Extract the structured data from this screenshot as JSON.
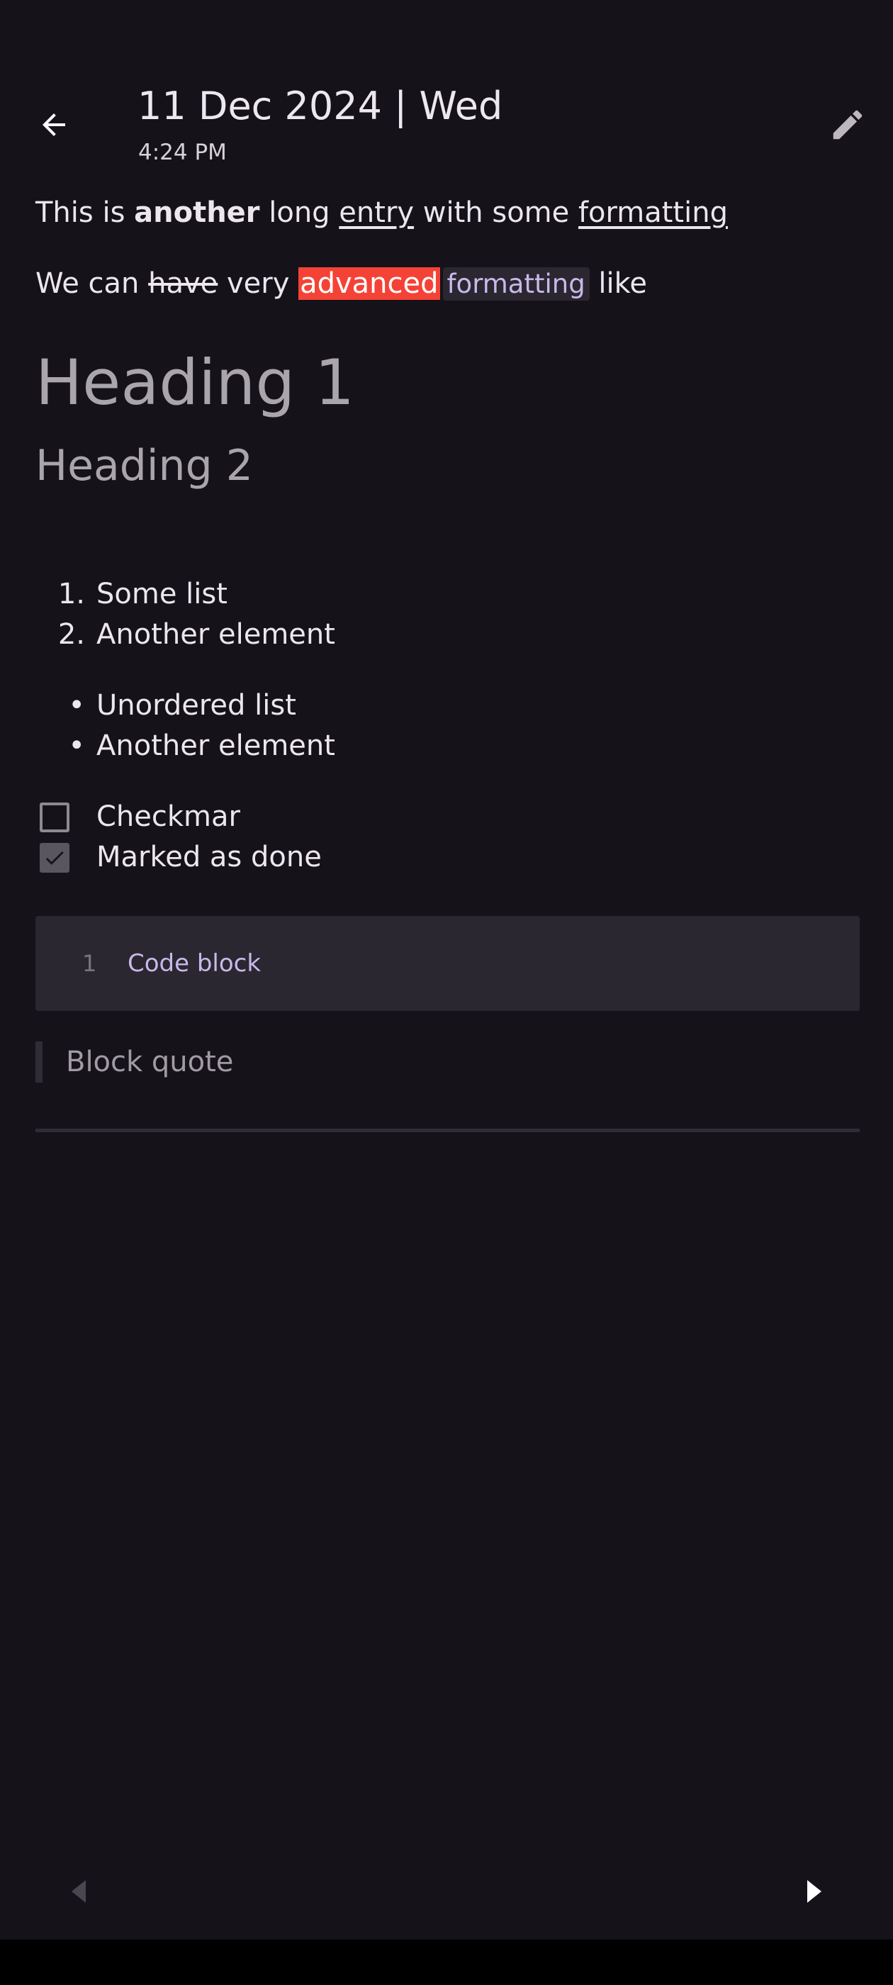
{
  "header": {
    "title": "11 Dec 2024 | Wed",
    "time": "4:24 PM",
    "back_icon": "arrow-back-icon",
    "edit_icon": "pencil-icon"
  },
  "entry": {
    "line1": {
      "t1": "This is ",
      "bold": "another",
      "t2": " long ",
      "u1": "entry",
      "t3": " with some ",
      "u2": "formatting"
    },
    "line2": {
      "t1": "We can ",
      "strike": "have",
      "t2": " very ",
      "highlight": "advanced",
      "code": "formatting",
      "t3": " like"
    },
    "heading1": "Heading 1",
    "heading2": "Heading 2",
    "ordered_list": [
      {
        "marker": "1.",
        "text": "Some list"
      },
      {
        "marker": "2.",
        "text": "Another element"
      }
    ],
    "unordered_list": [
      {
        "marker": "•",
        "text": "Unordered list"
      },
      {
        "marker": "•",
        "text": "Another element"
      }
    ],
    "tasks": [
      {
        "text": "Checkmar",
        "checked": false
      },
      {
        "text": "Marked as done",
        "checked": true
      }
    ],
    "code_block": {
      "line_number": "1",
      "code": "Code block"
    },
    "block_quote": "Block quote"
  },
  "nav": {
    "prev_icon": "previous-entry-icon",
    "next_icon": "next-entry-icon"
  },
  "colors": {
    "background": "#15121a",
    "highlight": "#f44336",
    "code_bg": "#2a2731",
    "code_text": "#c9b9ea"
  }
}
